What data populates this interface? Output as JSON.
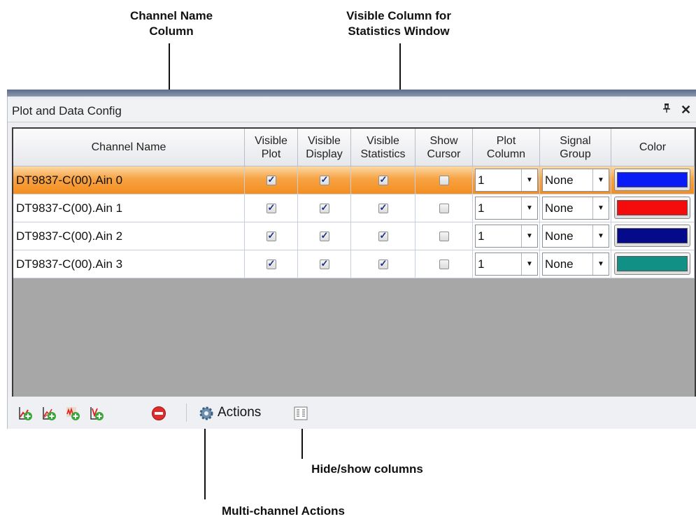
{
  "callouts": {
    "channel_name_col": "Channel Name\nColumn",
    "visible_stats_col": "Visible Column for\nStatistics Window",
    "hide_show": "Hide/show columns",
    "multi_actions": "Multi-channel Actions"
  },
  "panel": {
    "title": "Plot and Data Config",
    "pin_icon": "pin-icon",
    "close_icon": "close-icon"
  },
  "columns": {
    "channel_name": "Channel Name",
    "visible_plot": "Visible\nPlot",
    "visible_display": "Visible\nDisplay",
    "visible_statistics": "Visible\nStatistics",
    "show_cursor": "Show\nCursor",
    "plot_column": "Plot\nColumn",
    "signal_group": "Signal\nGroup",
    "color": "Color"
  },
  "rows": [
    {
      "name": "DT9837-C(00).Ain 0",
      "visible_plot": true,
      "visible_display": true,
      "visible_statistics": true,
      "show_cursor": false,
      "plot_column": "1",
      "signal_group": "None",
      "color": "#0a1cf5",
      "selected": true
    },
    {
      "name": "DT9837-C(00).Ain 1",
      "visible_plot": true,
      "visible_display": true,
      "visible_statistics": true,
      "show_cursor": false,
      "plot_column": "1",
      "signal_group": "None",
      "color": "#f40c0c",
      "selected": false
    },
    {
      "name": "DT9837-C(00).Ain 2",
      "visible_plot": true,
      "visible_display": true,
      "visible_statistics": true,
      "show_cursor": false,
      "plot_column": "1",
      "signal_group": "None",
      "color": "#050a8a",
      "selected": false
    },
    {
      "name": "DT9837-C(00).Ain 3",
      "visible_plot": true,
      "visible_display": true,
      "visible_statistics": true,
      "show_cursor": false,
      "plot_column": "1",
      "signal_group": "None",
      "color": "#119086",
      "selected": false
    }
  ],
  "toolbar": {
    "actions_label": "Actions",
    "icons": [
      "add-plot-icon",
      "add-multi-plot-icon",
      "add-fft-plot-icon",
      "add-xy-plot-icon",
      "remove-icon",
      "gear-icon",
      "columns-icon"
    ]
  },
  "colors": {
    "selected_row": "#f48e1f",
    "grid_empty": "#a7a7a7"
  }
}
